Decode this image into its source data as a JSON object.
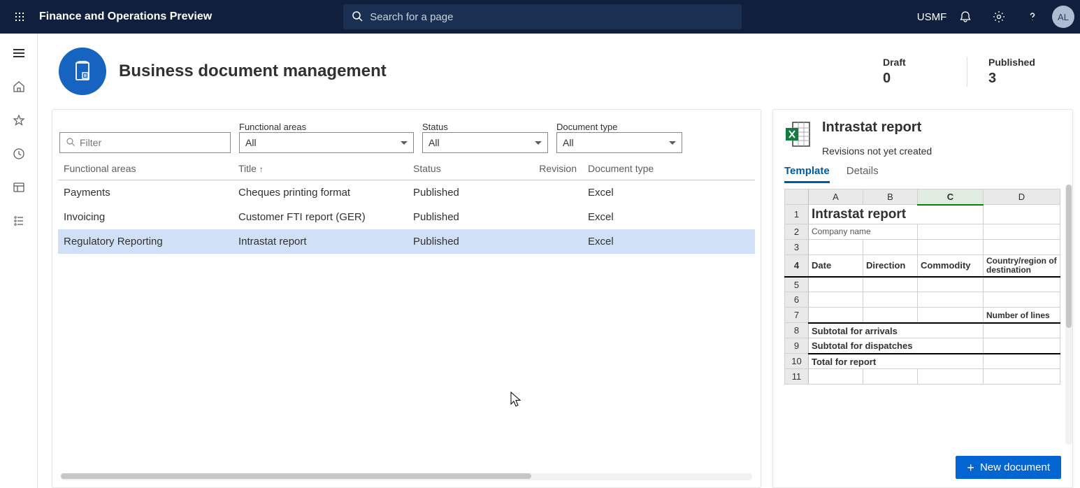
{
  "header": {
    "app_title": "Finance and Operations Preview",
    "search_placeholder": "Search for a page",
    "company": "USMF",
    "avatar_initials": "AL"
  },
  "workspace": {
    "title": "Business document management",
    "counts": {
      "draft_label": "Draft",
      "draft_value": "0",
      "published_label": "Published",
      "published_value": "3"
    }
  },
  "filters": {
    "filter_placeholder": "Filter",
    "functional_areas_label": "Functional areas",
    "functional_areas_value": "All",
    "status_label": "Status",
    "status_value": "All",
    "document_type_label": "Document type",
    "document_type_value": "All"
  },
  "columns": {
    "functional_areas": "Functional areas",
    "title": "Title",
    "status": "Status",
    "revision": "Revision",
    "document_type": "Document type"
  },
  "rows": [
    {
      "functional_area": "Payments",
      "title": "Cheques printing format",
      "status": "Published",
      "revision": "",
      "document_type": "Excel",
      "selected": false
    },
    {
      "functional_area": "Invoicing",
      "title": "Customer FTI report (GER)",
      "status": "Published",
      "revision": "",
      "document_type": "Excel",
      "selected": false
    },
    {
      "functional_area": "Regulatory Reporting",
      "title": "Intrastat report",
      "status": "Published",
      "revision": "",
      "document_type": "Excel",
      "selected": true
    }
  ],
  "detail": {
    "title": "Intrastat report",
    "subtitle": "Revisions not yet created",
    "tab_template": "Template",
    "tab_details": "Details",
    "new_document_label": "New document"
  },
  "sheet": {
    "col_headers": [
      "A",
      "B",
      "C",
      "D"
    ],
    "cells": {
      "r1_title": "Intrastat report",
      "r2_company": "Company name",
      "r4_date": "Date",
      "r4_direction": "Direction",
      "r4_commodity": "Commodity",
      "r4_country": "Country/region of destination",
      "r7_number": "Number of lines",
      "r8_sub_arr": "Subtotal for arrivals",
      "r9_sub_disp": "Subtotal for dispatches",
      "r10_total": "Total for report"
    }
  }
}
